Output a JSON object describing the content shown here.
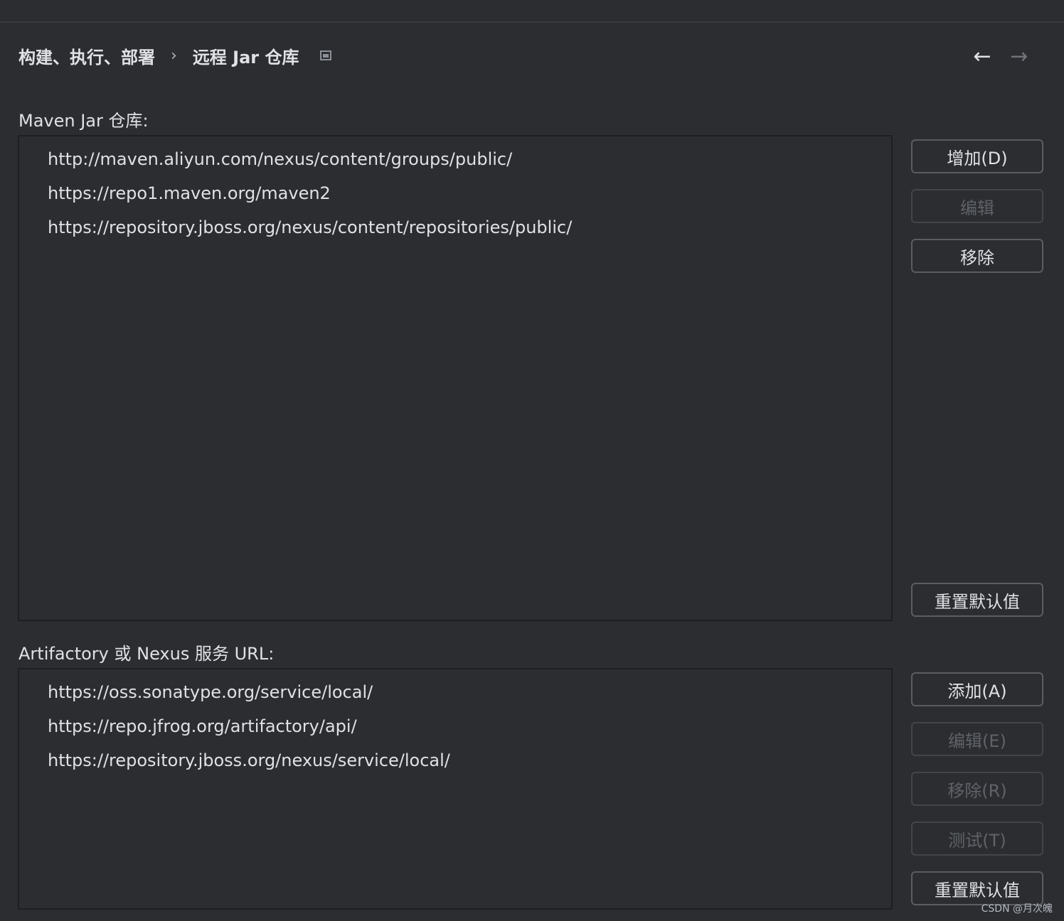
{
  "breadcrumb": {
    "parent": "构建、执行、部署",
    "separator": "›",
    "current": "远程 Jar 仓库"
  },
  "nav": {
    "back_icon": "←",
    "forward_icon": "→"
  },
  "maven": {
    "label": "Maven Jar 仓库:",
    "items": [
      "http://maven.aliyun.com/nexus/content/groups/public/",
      "https://repo1.maven.org/maven2",
      "https://repository.jboss.org/nexus/content/repositories/public/"
    ],
    "buttons": {
      "add": "增加(D)",
      "edit": "编辑",
      "remove": "移除",
      "reset": "重置默认值"
    }
  },
  "artifactory": {
    "label": "Artifactory 或 Nexus 服务 URL:",
    "items": [
      "https://oss.sonatype.org/service/local/",
      "https://repo.jfrog.org/artifactory/api/",
      "https://repository.jboss.org/nexus/service/local/"
    ],
    "buttons": {
      "add": "添加(A)",
      "edit": "编辑(E)",
      "remove": "移除(R)",
      "test": "测试(T)",
      "reset": "重置默认值"
    }
  },
  "watermark": "CSDN @月次魄"
}
